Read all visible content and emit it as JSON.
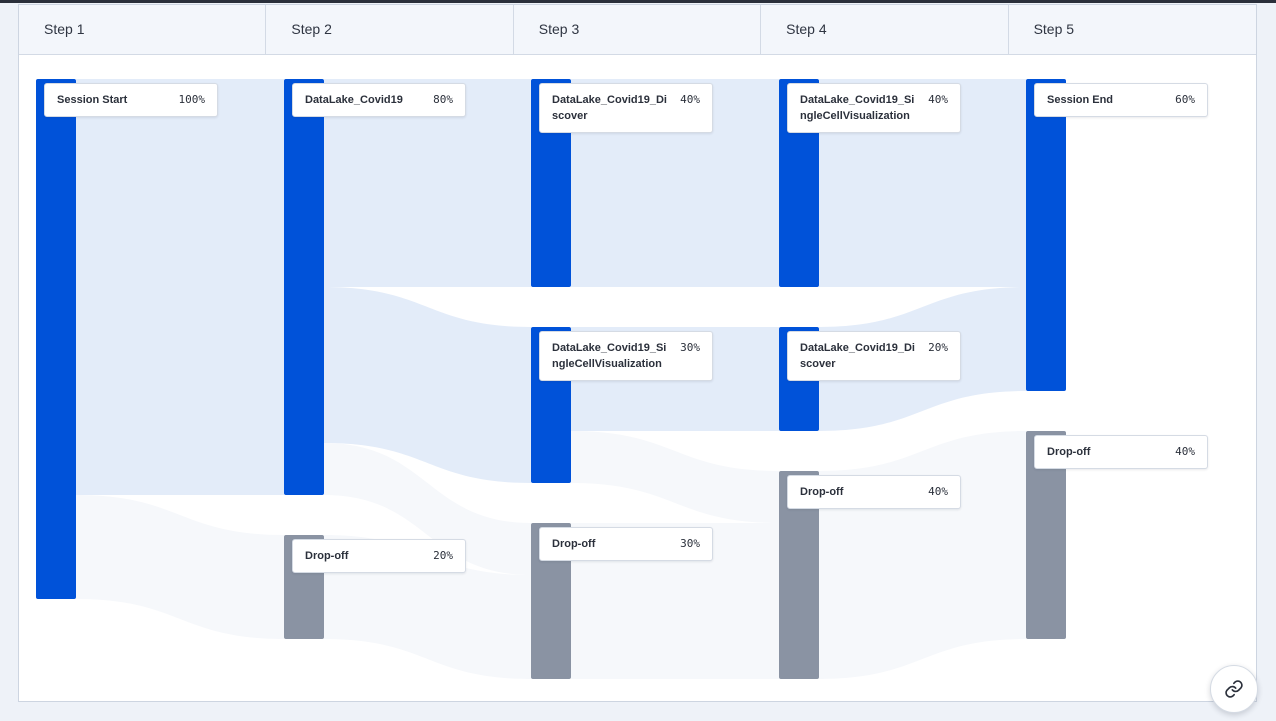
{
  "steps": [
    "Step 1",
    "Step 2",
    "Step 3",
    "Step 4",
    "Step 5"
  ],
  "chart_data": {
    "type": "sankey",
    "steps": [
      "Step 1",
      "Step 2",
      "Step 3",
      "Step 4",
      "Step 5"
    ],
    "nodes": [
      {
        "id": "s1_start",
        "step": 1,
        "name": "Session Start",
        "value": 100,
        "pct_label": "100%",
        "kind": "event"
      },
      {
        "id": "s2_covid",
        "step": 2,
        "name": "DataLake_Covid19",
        "value": 80,
        "pct_label": "80%",
        "kind": "event"
      },
      {
        "id": "s2_drop",
        "step": 2,
        "name": "Drop-off",
        "value": 20,
        "pct_label": "20%",
        "kind": "dropoff"
      },
      {
        "id": "s3_discover",
        "step": 3,
        "name": "DataLake_Covid19_Discover",
        "value": 40,
        "pct_label": "40%",
        "kind": "event"
      },
      {
        "id": "s3_single",
        "step": 3,
        "name": "DataLake_Covid19_SingleCellVisualization",
        "value": 30,
        "pct_label": "30%",
        "kind": "event"
      },
      {
        "id": "s3_drop",
        "step": 3,
        "name": "Drop-off",
        "value": 30,
        "pct_label": "30%",
        "kind": "dropoff"
      },
      {
        "id": "s4_single",
        "step": 4,
        "name": "DataLake_Covid19_SingleCellVisualization",
        "value": 40,
        "pct_label": "40%",
        "kind": "event"
      },
      {
        "id": "s4_discover",
        "step": 4,
        "name": "DataLake_Covid19_Discover",
        "value": 20,
        "pct_label": "20%",
        "kind": "event"
      },
      {
        "id": "s4_drop",
        "step": 4,
        "name": "Drop-off",
        "value": 40,
        "pct_label": "40%",
        "kind": "dropoff"
      },
      {
        "id": "s5_end",
        "step": 5,
        "name": "Session End",
        "value": 60,
        "pct_label": "60%",
        "kind": "event"
      },
      {
        "id": "s5_drop",
        "step": 5,
        "name": "Drop-off",
        "value": 40,
        "pct_label": "40%",
        "kind": "dropoff"
      }
    ],
    "links": [
      {
        "source": "s1_start",
        "target": "s2_covid",
        "value": 80
      },
      {
        "source": "s1_start",
        "target": "s2_drop",
        "value": 20
      },
      {
        "source": "s2_covid",
        "target": "s3_discover",
        "value": 40
      },
      {
        "source": "s2_covid",
        "target": "s3_single",
        "value": 30
      },
      {
        "source": "s2_covid",
        "target": "s3_drop",
        "value": 10
      },
      {
        "source": "s2_drop",
        "target": "s3_drop",
        "value": 20
      },
      {
        "source": "s3_discover",
        "target": "s4_single",
        "value": 40
      },
      {
        "source": "s3_single",
        "target": "s4_discover",
        "value": 20
      },
      {
        "source": "s3_single",
        "target": "s4_drop",
        "value": 10
      },
      {
        "source": "s3_drop",
        "target": "s4_drop",
        "value": 30
      },
      {
        "source": "s4_single",
        "target": "s5_end",
        "value": 40
      },
      {
        "source": "s4_discover",
        "target": "s5_end",
        "value": 20
      },
      {
        "source": "s4_drop",
        "target": "s5_drop",
        "value": 40
      }
    ],
    "colors": {
      "event": "#0052d9",
      "dropoff": "#8a93a3",
      "flow_event": "#e3ecf9",
      "flow_dropoff": "#f6f8fb"
    }
  },
  "share_button": {
    "icon": "link-icon"
  }
}
